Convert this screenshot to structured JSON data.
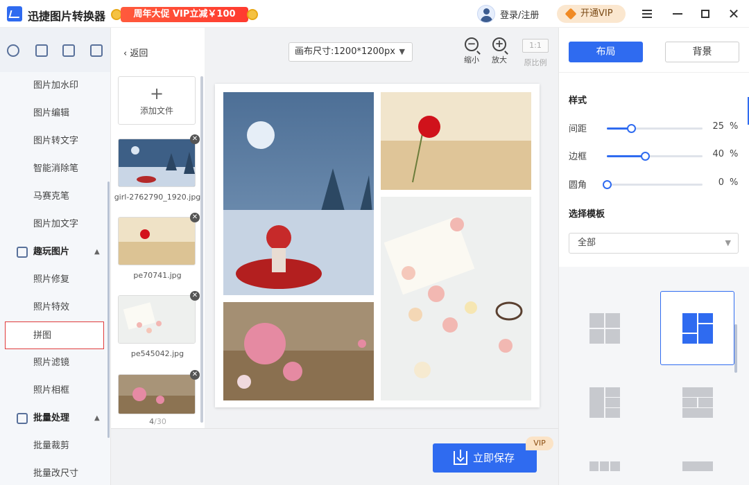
{
  "app": {
    "title": "迅捷图片转换器",
    "promo_text": "周年大促 VIP立减￥100",
    "login_text": "登录/注册",
    "vip_button": "开通VIP"
  },
  "sidebar": {
    "items": [
      {
        "label": "图片加水印"
      },
      {
        "label": "图片编辑"
      },
      {
        "label": "图片转文字"
      },
      {
        "label": "智能消除笔"
      },
      {
        "label": "马赛克笔"
      },
      {
        "label": "图片加文字"
      }
    ],
    "group_fun": "趣玩图片",
    "fun_items": [
      {
        "label": "照片修复"
      },
      {
        "label": "照片特效"
      },
      {
        "label": "拼图"
      },
      {
        "label": "照片滤镜"
      },
      {
        "label": "照片相框"
      }
    ],
    "group_batch": "批量处理",
    "batch_items": [
      {
        "label": "批量裁剪"
      },
      {
        "label": "批量改尺寸"
      }
    ],
    "active_item": "拼图"
  },
  "filelist": {
    "back_label": "返回",
    "add_label": "添加文件",
    "files": [
      {
        "name": "girl-2762790_1920.jpg"
      },
      {
        "name": "pe70741.jpg"
      },
      {
        "name": "pe545042.jpg"
      }
    ],
    "page_current": "4",
    "page_total": "/30"
  },
  "canvas": {
    "size_label": "画布尺寸:1200*1200px",
    "zoom_out_label": "缩小",
    "zoom_in_label": "放大",
    "ratio_button": "1:1",
    "ratio_label": "原比例"
  },
  "bottom": {
    "save_label": "立即保存",
    "vip_tag": "VIP"
  },
  "right_panel": {
    "tab_layout": "布局",
    "tab_background": "背景",
    "style_title": "样式",
    "sliders": [
      {
        "label": "间距",
        "value": "25",
        "unit": "%",
        "fraction": 0.25
      },
      {
        "label": "边框",
        "value": "40",
        "unit": "%",
        "fraction": 0.4
      },
      {
        "label": "圆角",
        "value": "0",
        "unit": "%",
        "fraction": 0.0
      }
    ],
    "template_title": "选择模板",
    "template_filter": "全部"
  },
  "colors": {
    "accent": "#2f6bf0",
    "promo_red": "#ff4a36",
    "active_border": "#e03a3a"
  }
}
